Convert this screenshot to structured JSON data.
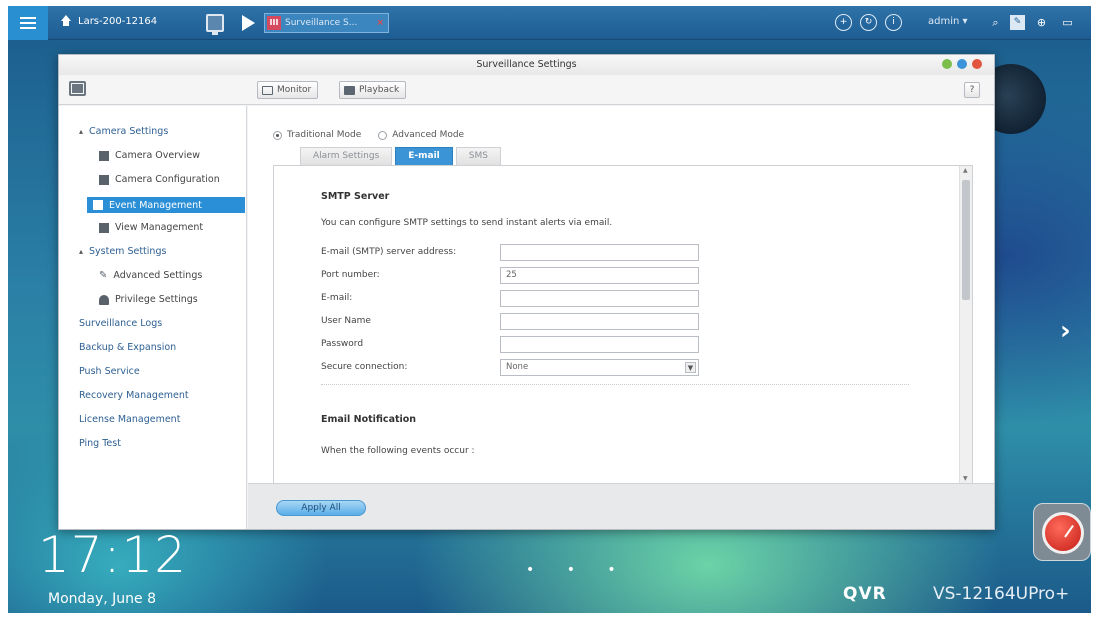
{
  "topbar": {
    "home_label": "Lars-200-12164",
    "app_tab_label": "Surveillance S...",
    "app_tab_badge": "III",
    "app_tab_close": "×",
    "admin_label": "admin ▾",
    "icons": [
      "menu-icon",
      "home-icon",
      "desktop-icon",
      "play-icon",
      "circle-plus-icon",
      "refresh-icon",
      "info-icon",
      "search-icon",
      "notes-icon",
      "network-icon",
      "monitor-icon"
    ]
  },
  "window": {
    "title": "Surveillance Settings",
    "toolbar": {
      "monitor_label": "Monitor",
      "playback_label": "Playback",
      "help_label": "?"
    }
  },
  "sidebar": {
    "camera_settings": "Camera Settings",
    "camera_overview": "Camera Overview",
    "camera_configuration": "Camera Configuration",
    "event_management": "Event Management",
    "view_management": "View Management",
    "system_settings": "System Settings",
    "advanced_settings": "Advanced Settings",
    "privilege_settings": "Privilege Settings",
    "surveillance_logs": "Surveillance Logs",
    "backup_expansion": "Backup & Expansion",
    "push_service": "Push Service",
    "recovery_management": "Recovery Management",
    "license_management": "License Management",
    "ping_test": "Ping Test"
  },
  "content": {
    "traditional_mode": "Traditional Mode",
    "advanced_mode": "Advanced Mode",
    "tabs": [
      "Alarm Settings",
      "E-mail",
      "SMS"
    ],
    "smtp_title": "SMTP Server",
    "smtp_desc": "You can configure SMTP settings to send instant alerts via email.",
    "fields": {
      "server_label": "E-mail (SMTP) server address:",
      "server_value": "",
      "port_label": "Port number:",
      "port_value": "25",
      "email_label": "E-mail:",
      "email_value": "",
      "username_label": "User Name",
      "username_value": "",
      "password_label": "Password",
      "password_value": "",
      "secure_label": "Secure connection:",
      "secure_value": "None"
    },
    "notif_title": "Email Notification",
    "notif_desc": "When the following events occur :",
    "apply_label": "Apply All"
  },
  "desktop": {
    "time": "17:12",
    "date": "Monday, June 8",
    "brand": "QVR",
    "model": "VS-12164UPro+",
    "next_arrow": "›",
    "page_dots": "• • •"
  },
  "colors": {
    "accent": "#2a8fd6",
    "topbar": "#1d5d93",
    "link": "#2d5f91"
  }
}
